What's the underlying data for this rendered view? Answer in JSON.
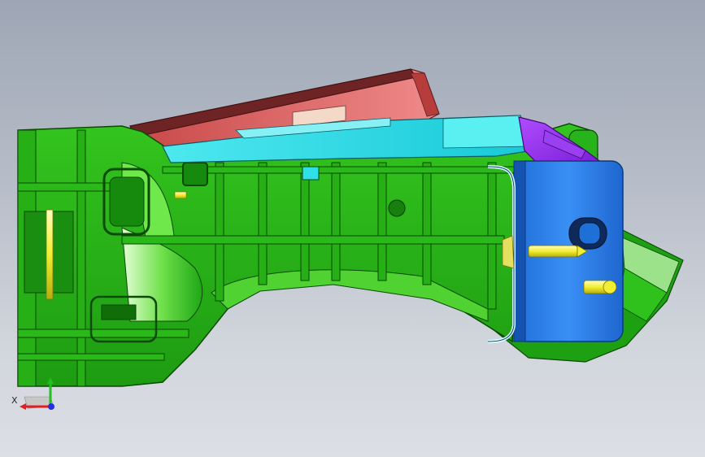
{
  "viewport": {
    "background_top": "#9ea6b5",
    "background_bottom": "#dcdfe4"
  },
  "model": {
    "parts": [
      {
        "name": "main-housing",
        "color": "#22b414"
      },
      {
        "name": "top-cover",
        "color": "#e87878"
      },
      {
        "name": "top-rail",
        "color": "#2fe0e8"
      },
      {
        "name": "end-plate",
        "color": "#2a7ff0"
      },
      {
        "name": "corner-block",
        "color": "#9a30f0"
      },
      {
        "name": "pins",
        "color": "#f2ee30"
      }
    ]
  },
  "triad": {
    "x_label": "X",
    "x_color": "#e02020",
    "y_color": "#20c020",
    "z_color": "#2030e0"
  }
}
